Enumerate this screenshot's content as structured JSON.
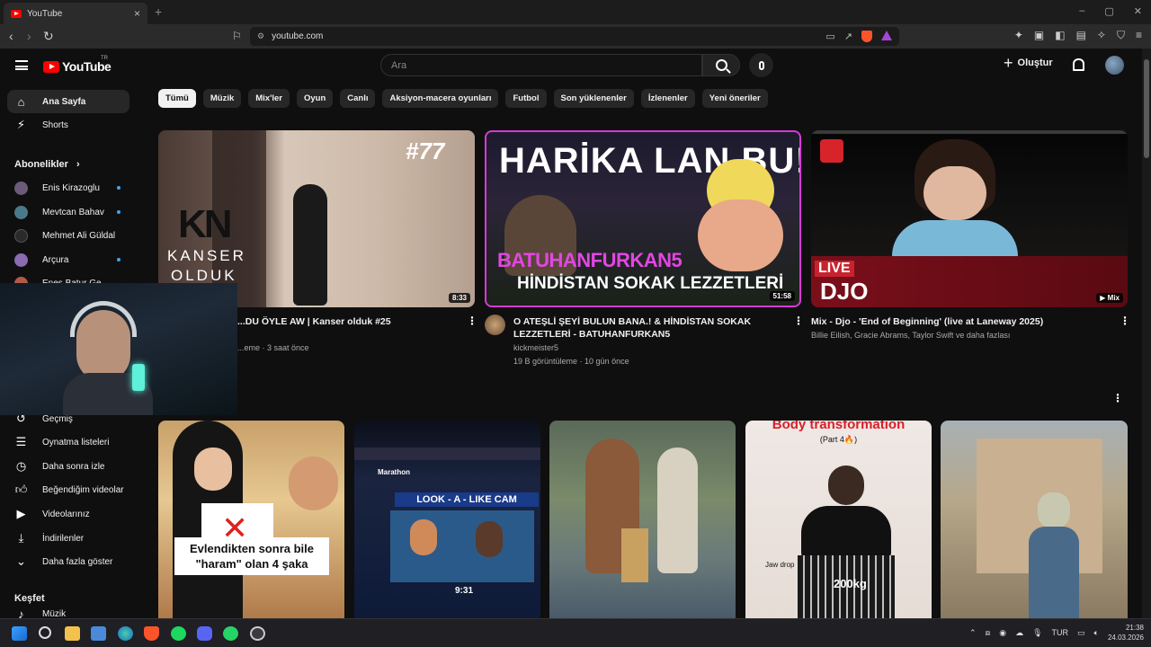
{
  "browser": {
    "tab_title": "YouTube",
    "tab_close": "×",
    "new_tab": "+",
    "url": "youtube.com",
    "window_controls": [
      "–",
      "▢",
      "✕"
    ]
  },
  "header": {
    "logo_text": "YouTube",
    "region": "TR",
    "search_placeholder": "Ara",
    "create_label": "Oluştur"
  },
  "sidebar": {
    "main": [
      {
        "label": "Ana Sayfa",
        "icon": "home-icon"
      },
      {
        "label": "Shorts",
        "icon": "shorts-icon"
      }
    ],
    "subscriptions_heading": "Abonelikler",
    "subscriptions": [
      {
        "label": "Enis Kirazoglu",
        "color": "#6b5a7a"
      },
      {
        "label": "Mevtcan Bahav",
        "color": "#4a7a8a"
      },
      {
        "label": "Mehmet Ali Güldal",
        "color": "#2a2a2a"
      },
      {
        "label": "Arçura",
        "color": "#8a6ab0"
      },
      {
        "label": "Enes Batur Ge",
        "color": "#b05a4a"
      }
    ],
    "you": [
      {
        "label": "Geçmiş",
        "icon": "history-icon"
      },
      {
        "label": "Oynatma listeleri",
        "icon": "playlist-icon"
      },
      {
        "label": "Daha sonra izle",
        "icon": "watch-later-icon"
      },
      {
        "label": "Beğendiğim videolar",
        "icon": "like-icon"
      },
      {
        "label": "Videolarınız",
        "icon": "your-videos-icon"
      },
      {
        "label": "İndirilenler",
        "icon": "download-icon"
      },
      {
        "label": "Daha fazla göster",
        "icon": "chevron-down-icon"
      }
    ],
    "explore_heading": "Keşfet",
    "explore_partial": "Müzik"
  },
  "chips": [
    "Tümü",
    "Müzik",
    "Mix'ler",
    "Oyun",
    "Canlı",
    "Aksiyon-macera oyunları",
    "Futbol",
    "Son yüklenenler",
    "İzlenenler",
    "Yeni öneriler"
  ],
  "videos": [
    {
      "thumb_text_1": "#77",
      "thumb_logo": "KN",
      "thumb_text_2": "KANSER",
      "thumb_text_3": "OLDUK",
      "duration": "8:33",
      "title": "...DU ÖYLE AW | Kanser olduk #25",
      "meta": "...eme · 3 saat önce"
    },
    {
      "thumb_text_1": "HARİKA LAN BU!",
      "thumb_text_2": "BATUHANFURKAN5",
      "thumb_text_3": "HİNDİSTAN SOKAK LEZZETLERİ",
      "duration": "51:58",
      "title_line1": "O ATEŞLİ ŞEYİ BULUN BANA.! & HİNDİSTAN SOKAK",
      "title_line2": "LEZZETLERİ - BATUHANFURKAN5",
      "channel": "kickmeister5",
      "meta": "19 B görüntüleme · 10 gün önce"
    },
    {
      "thumb_text_1": "LIVE",
      "thumb_text_2": "DJO",
      "badge": "Mix",
      "title": "Mix - Djo - 'End of Beginning' (live at Laneway 2025)",
      "meta": "Billie Eilish, Gracie Abrams, Taylor Swift ve daha fazlası"
    }
  ],
  "shorts": [
    {
      "caption": "Evlendikten sonra bile \"haram\" olan 4 şaka"
    },
    {
      "caption": "LOOK - A - LIKE CAM",
      "banner": "Marathon",
      "score": "9:31"
    },
    {
      "caption": ""
    },
    {
      "caption": "Body transformation",
      "sub": "(Part 4🔥)",
      "label_1": "Jaw drop",
      "label_2": "200kg"
    },
    {
      "caption": ""
    }
  ],
  "taskbar": {
    "language": "TUR",
    "time": "21:38",
    "date": "24.03.2026"
  }
}
